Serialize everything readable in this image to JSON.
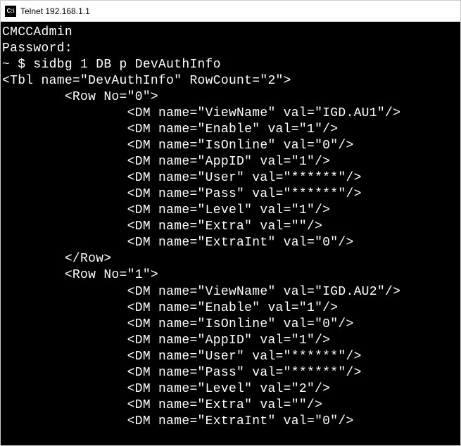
{
  "window": {
    "icon_label": "C:\\",
    "title": "Telnet 192.168.1.1"
  },
  "terminal": {
    "login_user": "CMCCAdmin",
    "password_label": "Password:",
    "prompt": "~ $ ",
    "command": "sidbg 1 DB p DevAuthInfo",
    "table_name": "DevAuthInfo",
    "row_count": "2",
    "rows": [
      {
        "no": "0",
        "dms": [
          {
            "name": "ViewName",
            "val": "IGD.AU1"
          },
          {
            "name": "Enable",
            "val": "1"
          },
          {
            "name": "IsOnline",
            "val": "0"
          },
          {
            "name": "AppID",
            "val": "1"
          },
          {
            "name": "User",
            "val": "******"
          },
          {
            "name": "Pass",
            "val": "******"
          },
          {
            "name": "Level",
            "val": "1"
          },
          {
            "name": "Extra",
            "val": ""
          },
          {
            "name": "ExtraInt",
            "val": "0"
          }
        ]
      },
      {
        "no": "1",
        "dms": [
          {
            "name": "ViewName",
            "val": "IGD.AU2"
          },
          {
            "name": "Enable",
            "val": "1"
          },
          {
            "name": "IsOnline",
            "val": "0"
          },
          {
            "name": "AppID",
            "val": "1"
          },
          {
            "name": "User",
            "val": "******"
          },
          {
            "name": "Pass",
            "val": "******"
          },
          {
            "name": "Level",
            "val": "2"
          },
          {
            "name": "Extra",
            "val": ""
          },
          {
            "name": "ExtraInt",
            "val": "0"
          }
        ]
      }
    ]
  }
}
